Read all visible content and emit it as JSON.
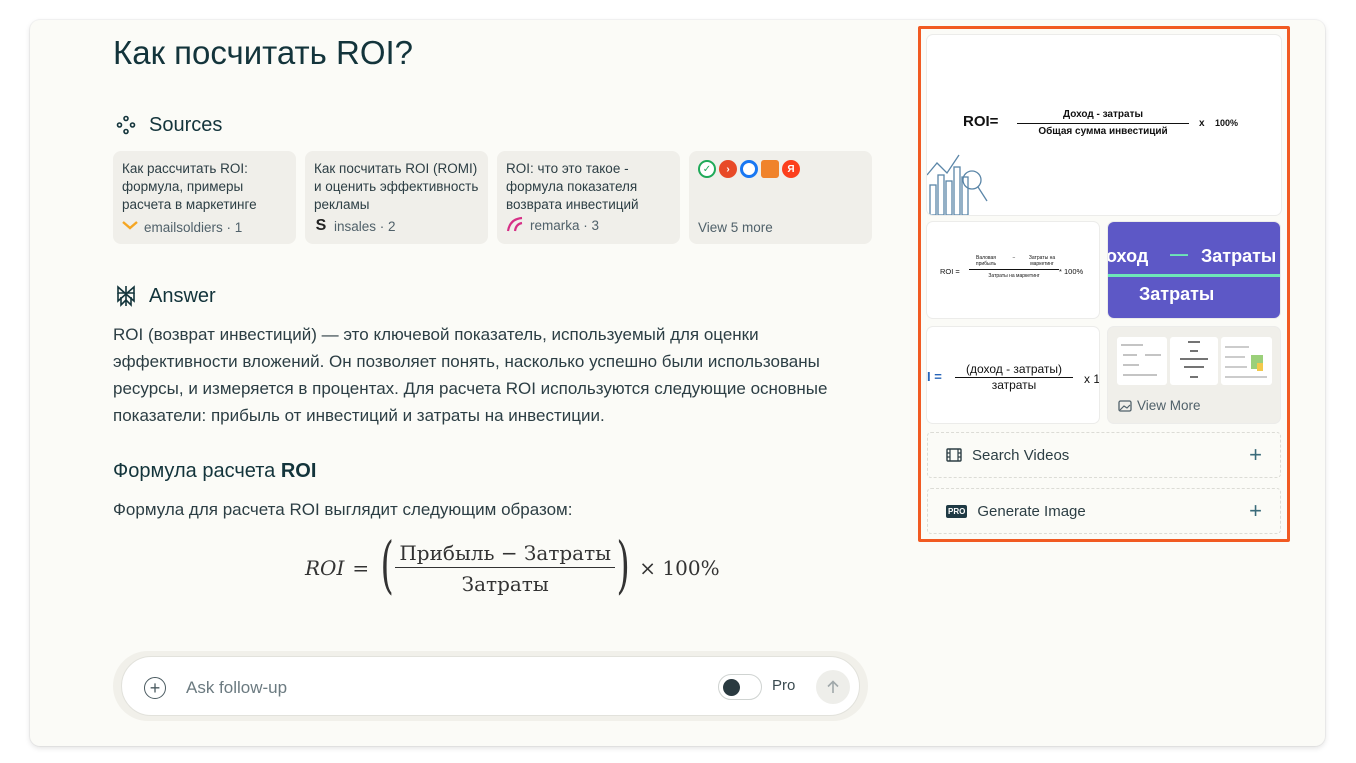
{
  "page": {
    "title": "Как посчитать ROI?"
  },
  "sources": {
    "heading": "Sources",
    "items": [
      {
        "title": "Как рассчитать ROI: формула, примеры расчета в маркетинге",
        "site": "emailsoldiers · 1",
        "favicon_color": "#f5a623"
      },
      {
        "title": "Как посчитать ROI (ROMI) и оценить эффективность рекламы",
        "site": "insales · 2",
        "favicon_color": "#222222"
      },
      {
        "title": "ROI: что это такое - формула показателя возврата инвестиций",
        "site": "remarka · 3",
        "favicon_color": "#d62f86"
      }
    ],
    "more_label": "View 5 more",
    "more_icons": [
      {
        "name": "check-favicon-icon",
        "color": "#1faa59"
      },
      {
        "name": "arrow-favicon-icon",
        "color": "#e84a27"
      },
      {
        "name": "circle-favicon-icon",
        "color": "#1877f2"
      },
      {
        "name": "box-favicon-icon",
        "color": "#f0832b"
      },
      {
        "name": "yandex-favicon-icon",
        "color": "#fc3f1d"
      }
    ]
  },
  "answer": {
    "heading": "Answer",
    "intro": "ROI (возврат инвестиций) — это ключевой показатель, используемый для оценки эффективности вложений. Он позволяет понять, насколько успешно были использованы ресурсы, и измеряется в процентах. Для расчета ROI используются следующие основные показатели: прибыль от инвестиций и затраты на инвестиции.",
    "subheading_plain": "Формула расчета ",
    "subheading_bold": "ROI",
    "formula_intro": "Формула для расчета ROI выглядит следующим образом:",
    "formula": {
      "lhs": "ROI",
      "eq": "=",
      "numerator": "Прибыль − Затраты",
      "denominator": "Затраты",
      "times": "× 100%"
    }
  },
  "followup": {
    "placeholder": "Ask follow-up",
    "pro_label": "Pro"
  },
  "sidebar": {
    "main_image": {
      "lhs": "ROI=",
      "numerator": "Доход - затраты",
      "denominator": "Общая сумма инвестиций",
      "multiplier": "x",
      "percent": "100%"
    },
    "tile2": {
      "lhs": "ROI =",
      "a": "Валовая прибыль",
      "minus": "−",
      "b": "Затраты на маркетинг",
      "den": "Затраты на маркетинг",
      "mult": "* 100%"
    },
    "tile3": {
      "top_left": "оход",
      "dash": "—",
      "top_right": "Затраты",
      "bottom": "Затраты"
    },
    "tile4": {
      "lhs": "I =",
      "numerator": "(доход - затраты)",
      "denominator": "затраты",
      "mult": "x 1"
    },
    "view_more": "View More",
    "search_videos": "Search Videos",
    "generate_image": "Generate Image",
    "pro_badge": "PRO"
  }
}
